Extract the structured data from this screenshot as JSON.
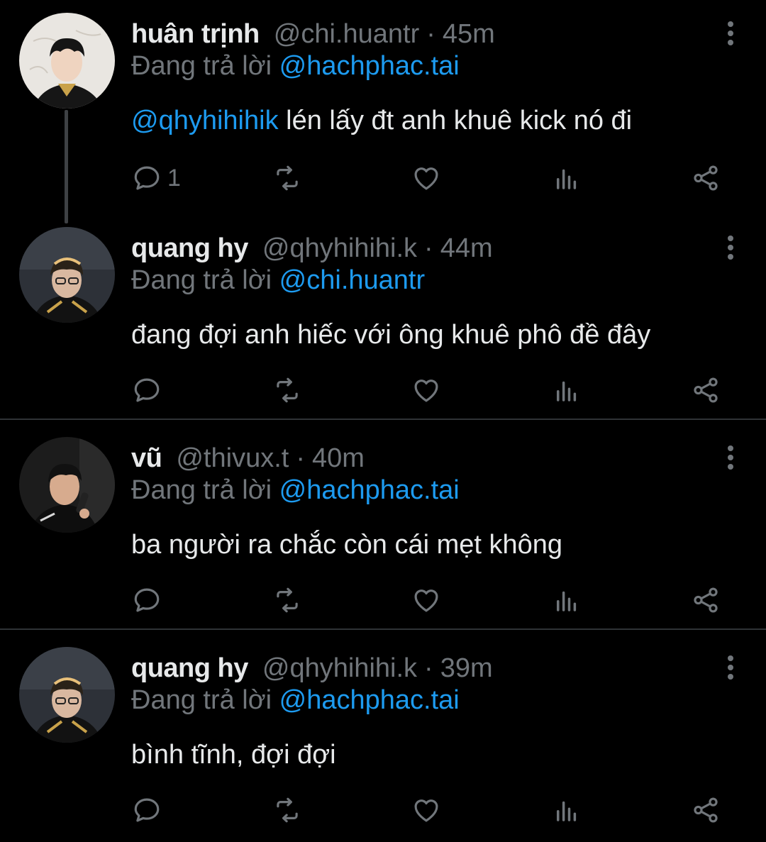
{
  "tweets": [
    {
      "name": "huân trịnh",
      "handle": "@chi.huantr",
      "separator": "·",
      "time": "45m",
      "reply_prefix": "Đang trả lời",
      "reply_to": "@hachphac.tai",
      "body_mention": "@qhyhihihik",
      "body_text": " lén lấy đt anh khuê kick nó đi",
      "reply_count": "1"
    },
    {
      "name": "quang hy",
      "handle": "@qhyhihihi.k",
      "separator": "·",
      "time": "44m",
      "reply_prefix": "Đang trả lời",
      "reply_to": "@chi.huantr",
      "body_text": "đang đợi anh hiếc với ông khuê phô đề đây",
      "reply_count": ""
    },
    {
      "name": "vũ",
      "handle": "@thivux.t",
      "separator": "·",
      "time": "40m",
      "reply_prefix": "Đang trả lời",
      "reply_to": "@hachphac.tai",
      "body_text": "ba người ra chắc còn cái mẹt không",
      "reply_count": ""
    },
    {
      "name": "quang hy",
      "handle": "@qhyhihihi.k",
      "separator": "·",
      "time": "39m",
      "reply_prefix": "Đang trả lời",
      "reply_to": "@hachphac.tai",
      "body_text": "bình tĩnh, đợi đợi",
      "reply_count": ""
    }
  ],
  "colors": {
    "background": "#000000",
    "text": "#e7e9ea",
    "muted": "#71767b",
    "accent": "#1d9bf0",
    "divider": "#2f3336"
  },
  "icons": [
    "reply-icon",
    "retweet-icon",
    "like-icon",
    "views-icon",
    "share-icon",
    "more-icon"
  ]
}
